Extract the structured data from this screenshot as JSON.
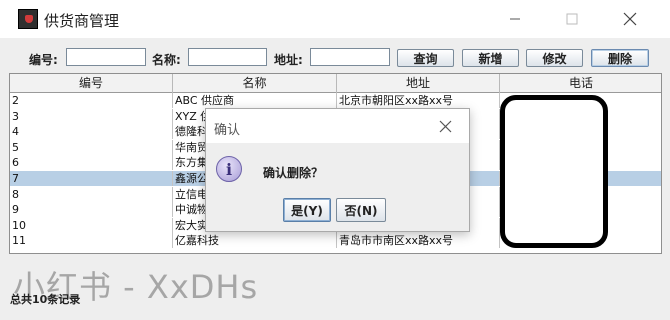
{
  "window": {
    "title": "供货商管理",
    "min_icon": "minimize-icon",
    "max_icon": "maximize-icon",
    "close_icon": "close-icon"
  },
  "toolbar": {
    "id_label": "编号:",
    "name_label": "名称:",
    "address_label": "地址:",
    "id_value": "",
    "name_value": "",
    "address_value": "",
    "search_label": "查询",
    "add_label": "新增",
    "edit_label": "修改",
    "delete_label": "删除"
  },
  "table": {
    "columns": [
      "编号",
      "名称",
      "地址",
      "电话"
    ],
    "rows": [
      {
        "id": "2",
        "name": "ABC 供应商",
        "address": "北京市朝阳区xx路xx号",
        "phone": "",
        "selected": false
      },
      {
        "id": "3",
        "name": "XYZ 供",
        "address": "",
        "phone": "",
        "selected": false
      },
      {
        "id": "4",
        "name": "德隆科",
        "address": "",
        "phone": "",
        "selected": false
      },
      {
        "id": "5",
        "name": "华南贸",
        "address": "",
        "phone": "",
        "selected": false
      },
      {
        "id": "6",
        "name": "东方集",
        "address": "",
        "phone": "",
        "selected": false
      },
      {
        "id": "7",
        "name": "鑫源公",
        "address": "",
        "phone": "",
        "selected": true
      },
      {
        "id": "8",
        "name": "立信电",
        "address": "",
        "phone": "",
        "selected": false
      },
      {
        "id": "9",
        "name": "中诚物",
        "address": "",
        "phone": "",
        "selected": false
      },
      {
        "id": "10",
        "name": "宏大实",
        "address": "",
        "phone": "",
        "selected": false
      },
      {
        "id": "11",
        "name": "亿嘉科技",
        "address": "青岛市市南区xx路xx号",
        "phone": "",
        "selected": false
      }
    ]
  },
  "footer": {
    "record_count": "总共10条记录"
  },
  "watermark": "小红书 - XxDHs",
  "dialog": {
    "title": "确认",
    "message": "确认删除？",
    "icon": "info-icon",
    "yes_label": "是(Y)",
    "no_label": "否(N)"
  },
  "colors": {
    "selection": "#b8cfe5",
    "header_bg": "#f2f2f2",
    "window_bg": "#eeeeee"
  }
}
